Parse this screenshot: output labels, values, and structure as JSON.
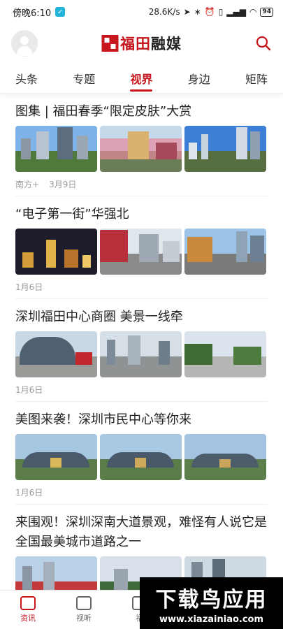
{
  "status_bar": {
    "time": "傍晚6:10",
    "network_speed": "28.6K/s",
    "icons": [
      "location-icon",
      "bluetooth-icon",
      "alarm-icon",
      "vibrate-icon",
      "signal-icon",
      "wifi-icon"
    ],
    "battery": "94"
  },
  "header": {
    "brand_prefix": "福田",
    "brand_suffix": "融媒"
  },
  "tabs": [
    "头条",
    "专题",
    "视界",
    "身边",
    "矩阵"
  ],
  "active_tab": "视界",
  "articles": [
    {
      "title": "图集 | 福田春季“限定皮肤”大赏",
      "source": "南方+",
      "date": "3月9日"
    },
    {
      "title": "“电子第一街”华强北",
      "source": "",
      "date": "1月6日"
    },
    {
      "title": "深圳福田中心商圈 美景一线牵",
      "source": "",
      "date": "1月6日"
    },
    {
      "title": "美图来袭！深圳市民中心等你来",
      "source": "",
      "date": "1月6日"
    },
    {
      "title": "来围观！深圳深南大道景观，难怪有人说它是全国最美城市道路之一",
      "source": "",
      "date": ""
    }
  ],
  "bottom_nav": [
    {
      "label": "资讯",
      "icon": "news-icon"
    },
    {
      "label": "视听",
      "icon": "video-icon"
    },
    {
      "label": "福",
      "icon": "service-icon"
    }
  ],
  "watermark": {
    "main": "下载鸟应用",
    "url": "www.xiazainiao.com"
  },
  "colors": {
    "accent": "#c8161d",
    "sky": "#6ea6dc"
  }
}
